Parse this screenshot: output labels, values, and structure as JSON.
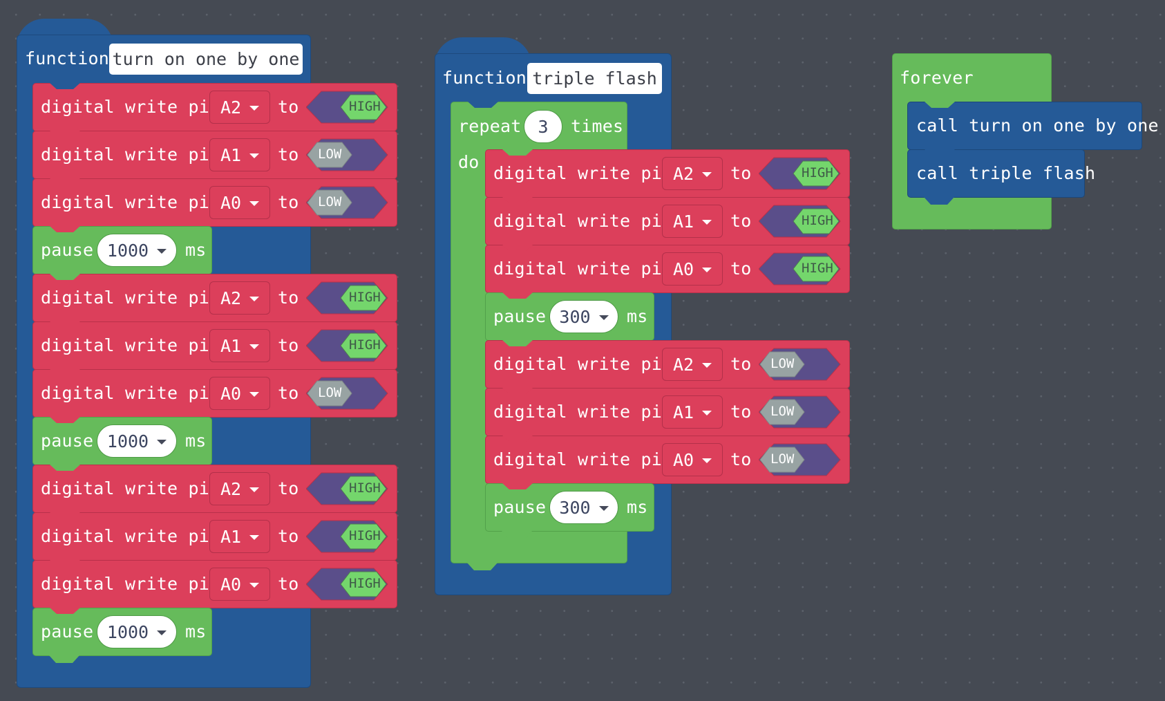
{
  "colors": {
    "workspace": "#454a53",
    "function_block": "#255a97",
    "pin_block": "#dc3f5b",
    "loop_block": "#66bb5b",
    "toggle_track": "#5a4e8a",
    "high": "#74d66c",
    "low": "#98a3a3"
  },
  "functions": [
    {
      "keyword": "function",
      "name": "turn on one by one",
      "blocks": [
        {
          "type": "digital_write",
          "label": "digital write pin",
          "pin": "A2",
          "to": "to",
          "value": "HIGH"
        },
        {
          "type": "digital_write",
          "label": "digital write pin",
          "pin": "A1",
          "to": "to",
          "value": "LOW"
        },
        {
          "type": "digital_write",
          "label": "digital write pin",
          "pin": "A0",
          "to": "to",
          "value": "LOW"
        },
        {
          "type": "pause",
          "label": "pause",
          "value": "1000",
          "unit": "ms"
        },
        {
          "type": "digital_write",
          "label": "digital write pin",
          "pin": "A2",
          "to": "to",
          "value": "HIGH"
        },
        {
          "type": "digital_write",
          "label": "digital write pin",
          "pin": "A1",
          "to": "to",
          "value": "HIGH"
        },
        {
          "type": "digital_write",
          "label": "digital write pin",
          "pin": "A0",
          "to": "to",
          "value": "LOW"
        },
        {
          "type": "pause",
          "label": "pause",
          "value": "1000",
          "unit": "ms"
        },
        {
          "type": "digital_write",
          "label": "digital write pin",
          "pin": "A2",
          "to": "to",
          "value": "HIGH"
        },
        {
          "type": "digital_write",
          "label": "digital write pin",
          "pin": "A1",
          "to": "to",
          "value": "HIGH"
        },
        {
          "type": "digital_write",
          "label": "digital write pin",
          "pin": "A0",
          "to": "to",
          "value": "HIGH"
        },
        {
          "type": "pause",
          "label": "pause",
          "value": "1000",
          "unit": "ms"
        }
      ]
    },
    {
      "keyword": "function",
      "name": "triple flash",
      "repeat": {
        "label": "repeat",
        "count": "3",
        "suffix": "times",
        "do_label": "do"
      },
      "blocks": [
        {
          "type": "digital_write",
          "label": "digital write pin",
          "pin": "A2",
          "to": "to",
          "value": "HIGH"
        },
        {
          "type": "digital_write",
          "label": "digital write pin",
          "pin": "A1",
          "to": "to",
          "value": "HIGH"
        },
        {
          "type": "digital_write",
          "label": "digital write pin",
          "pin": "A0",
          "to": "to",
          "value": "HIGH"
        },
        {
          "type": "pause",
          "label": "pause",
          "value": "300",
          "unit": "ms"
        },
        {
          "type": "digital_write",
          "label": "digital write pin",
          "pin": "A2",
          "to": "to",
          "value": "LOW"
        },
        {
          "type": "digital_write",
          "label": "digital write pin",
          "pin": "A1",
          "to": "to",
          "value": "LOW"
        },
        {
          "type": "digital_write",
          "label": "digital write pin",
          "pin": "A0",
          "to": "to",
          "value": "LOW"
        },
        {
          "type": "pause",
          "label": "pause",
          "value": "300",
          "unit": "ms"
        }
      ]
    }
  ],
  "forever": {
    "label": "forever",
    "calls": [
      {
        "label": "call turn on one by one"
      },
      {
        "label": "call triple flash"
      }
    ]
  }
}
